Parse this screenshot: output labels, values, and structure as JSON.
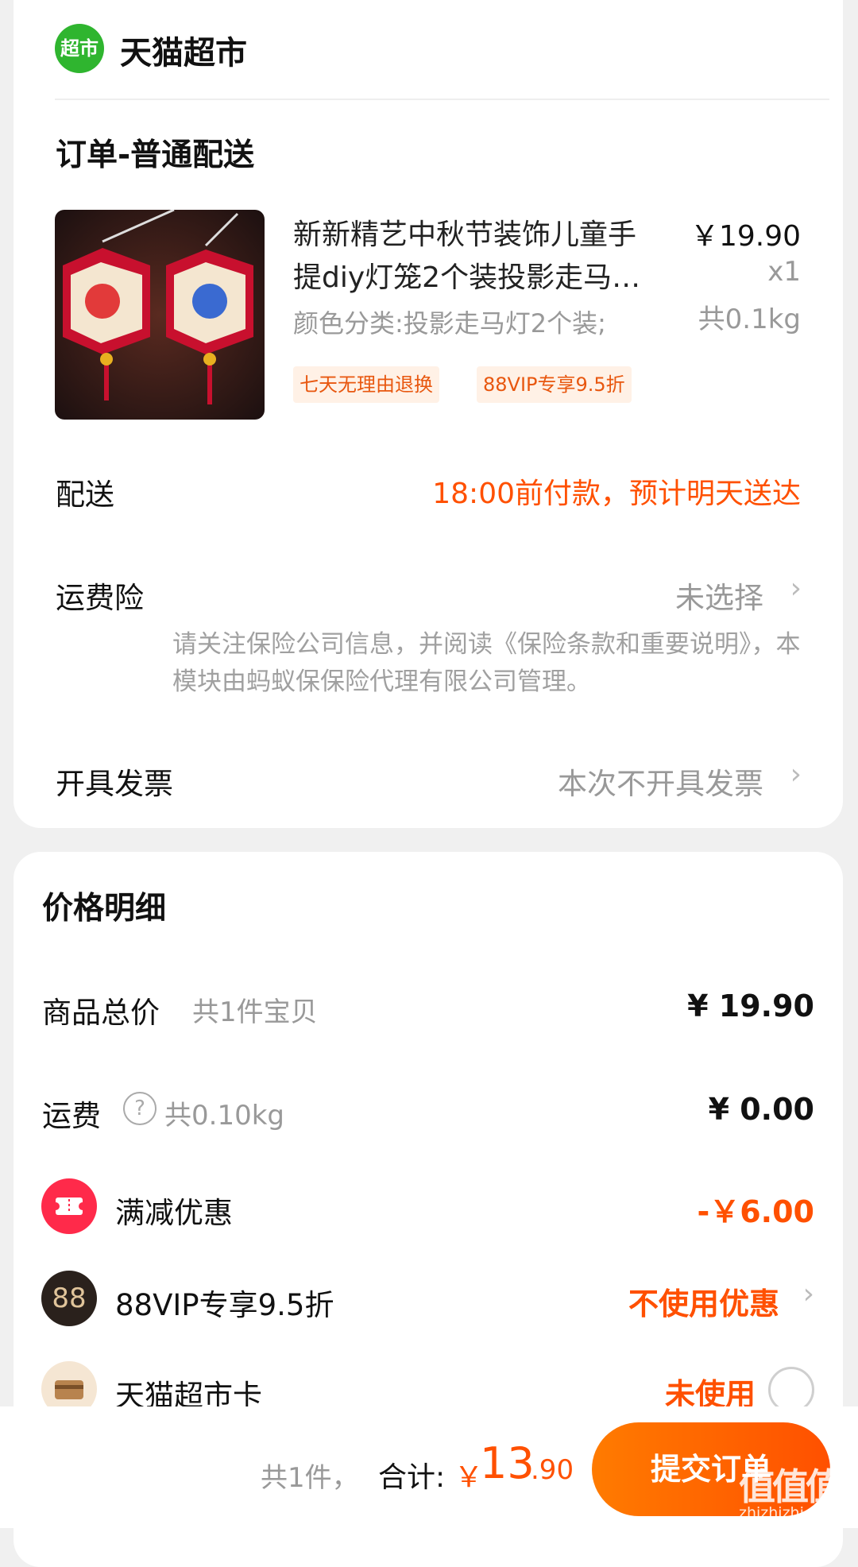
{
  "store": {
    "logo_text": "超市",
    "name": "天猫超市"
  },
  "order": {
    "section_title": "订单-普通配送",
    "item": {
      "title_line1": "新新精艺中秋节装饰儿童手",
      "title_line2": "提diy灯笼2个装投影走马…",
      "spec": "颜色分类:投影走马灯2个装;",
      "price": "￥19.90",
      "qty": "x1",
      "weight": "共0.1kg",
      "tags": [
        "七天无理由退换",
        "88VIP专享9.5折"
      ]
    }
  },
  "delivery": {
    "label": "配送",
    "value": "18:00前付款，预计明天送达"
  },
  "insurance": {
    "label": "运费险",
    "value": "未选择",
    "disclaimer": "请关注保险公司信息，并阅读《保险条款和重要说明》，本模块由蚂蚁保保险代理有限公司管理。"
  },
  "invoice": {
    "label": "开具发票",
    "value": "本次不开具发票"
  },
  "price_detail": {
    "title": "价格明细",
    "goods_total": {
      "label": "商品总价",
      "sub": "共1件宝贝",
      "value": "¥ 19.90"
    },
    "shipping": {
      "label": "运费",
      "sub": "共0.10kg",
      "value": "¥ 0.00"
    },
    "discount": {
      "label": "满减优惠",
      "value": "-￥6.00"
    },
    "vip": {
      "icon_text": "88",
      "label": "88VIP专享9.5折",
      "value": "不使用优惠"
    },
    "card": {
      "label": "天猫超市卡",
      "value": "未使用"
    }
  },
  "footer": {
    "count": "共1件，",
    "total_label": "合计:",
    "currency": "￥",
    "amount_int": "13",
    "amount_dec": ".90",
    "submit": "提交订单"
  },
  "watermark": {
    "main": "值值值",
    "sub": "zhizhizhi.com"
  },
  "colors": {
    "accent": "#ff5000",
    "store_green": "#2fb52f",
    "discount_red": "#ff2a4a"
  }
}
